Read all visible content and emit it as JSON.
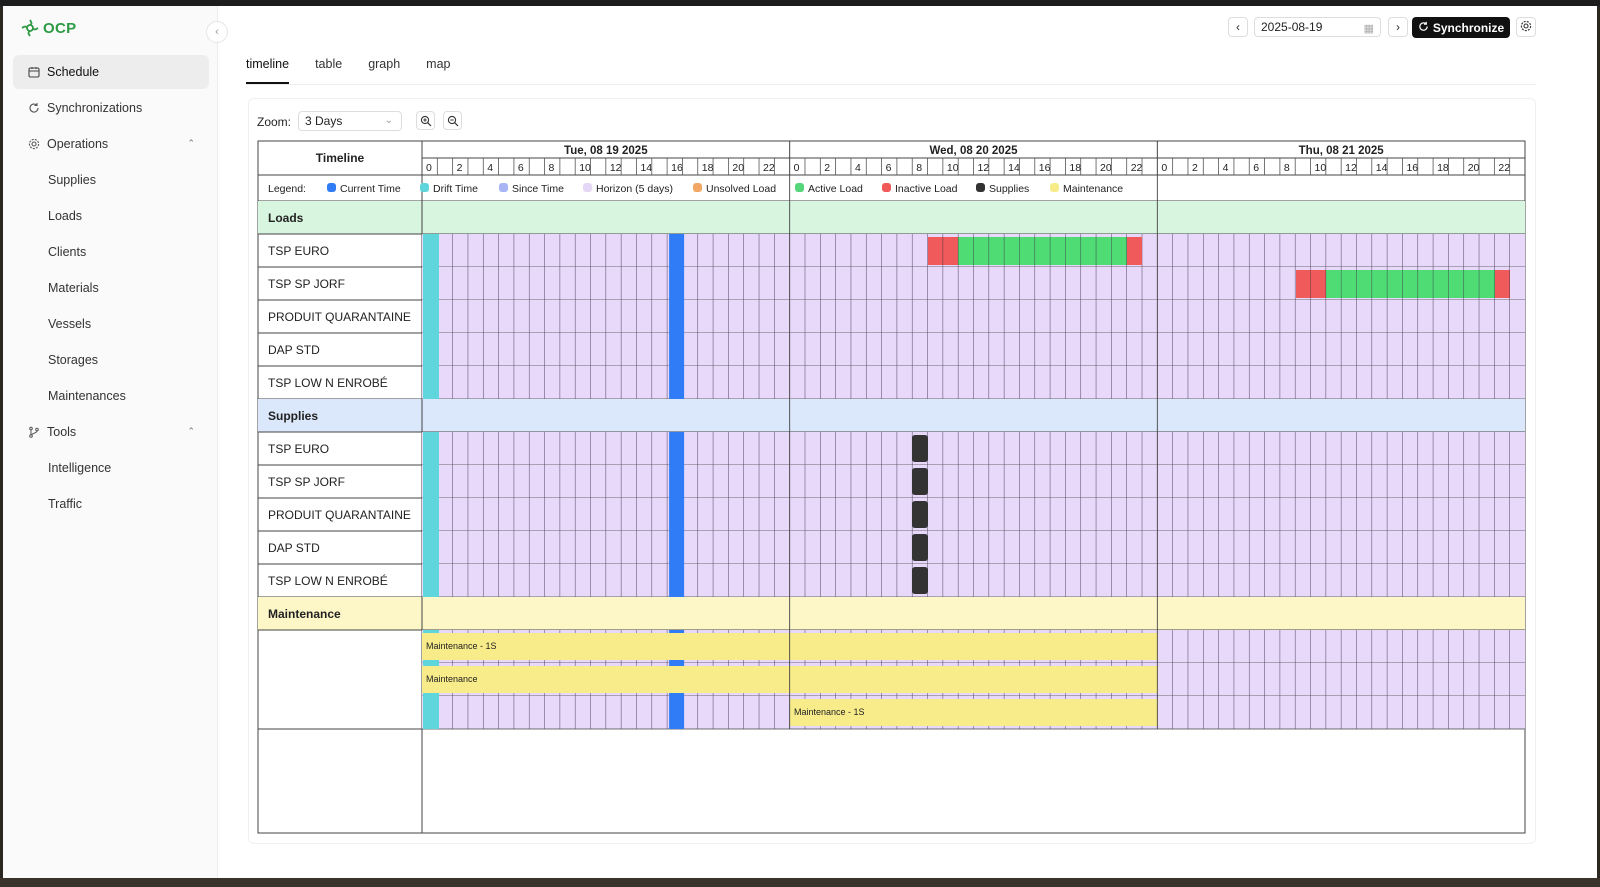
{
  "app": {
    "logo_text": "OCP"
  },
  "sidebar": {
    "items": [
      {
        "label": "Schedule",
        "icon": "calendar-icon",
        "active": true
      },
      {
        "label": "Synchronizations",
        "icon": "refresh-icon"
      },
      {
        "label": "Operations",
        "icon": "gear-icon",
        "expanded": true,
        "children": [
          "Supplies",
          "Loads",
          "Clients",
          "Materials",
          "Vessels",
          "Storages",
          "Maintenances"
        ]
      },
      {
        "label": "Tools",
        "icon": "git-branch-icon",
        "expanded": true,
        "children": [
          "Intelligence",
          "Traffic"
        ]
      }
    ]
  },
  "header": {
    "date": "2025-08-19",
    "sync_label": "Synchronize"
  },
  "tabs": [
    {
      "label": "timeline",
      "active": true
    },
    {
      "label": "table"
    },
    {
      "label": "graph"
    },
    {
      "label": "map"
    }
  ],
  "zoom": {
    "label": "Zoom:",
    "value": "3 Days"
  },
  "timeline": {
    "header_label": "Timeline",
    "days": [
      "Tue, 08 19 2025",
      "Wed, 08 20 2025",
      "Thu, 08 21 2025"
    ],
    "hour_labels": [
      "0",
      "2",
      "4",
      "6",
      "8",
      "10",
      "12",
      "14",
      "16",
      "18",
      "20",
      "22"
    ],
    "legend_label": "Legend:",
    "legend": [
      {
        "label": "Current Time",
        "color": "#2f7cf6"
      },
      {
        "label": "Drift Time",
        "color": "#5fd6dc"
      },
      {
        "label": "Since Time",
        "color": "#a9b6f5"
      },
      {
        "label": "Horizon (5 days)",
        "color": "#e6d7f7"
      },
      {
        "label": "Unsolved Load",
        "color": "#f3a765"
      },
      {
        "label": "Active Load",
        "color": "#55d67a"
      },
      {
        "label": "Inactive Load",
        "color": "#f25a5a"
      },
      {
        "label": "Supplies",
        "color": "#333333"
      },
      {
        "label": "Maintenance",
        "color": "#f8ec8a"
      }
    ],
    "sections": [
      {
        "title": "Loads",
        "bg": "#d8f5df",
        "rows": [
          "TSP EURO",
          "TSP SP JORF",
          "PRODUIT QUARANTAINE",
          "DAP STD",
          "TSP LOW N ENROBÉ"
        ]
      },
      {
        "title": "Supplies",
        "bg": "#dbe8fb",
        "rows": [
          "TSP EURO",
          "TSP SP JORF",
          "PRODUIT QUARANTAINE",
          "DAP STD",
          "TSP LOW N ENROBÉ"
        ]
      },
      {
        "title": "Maintenance",
        "bg": "#fdf7c8",
        "rows": [
          "",
          "",
          ""
        ]
      }
    ],
    "maintenance_labels": [
      "Maintenance - 1S",
      "Maintenance",
      "Maintenance - 1S"
    ]
  }
}
